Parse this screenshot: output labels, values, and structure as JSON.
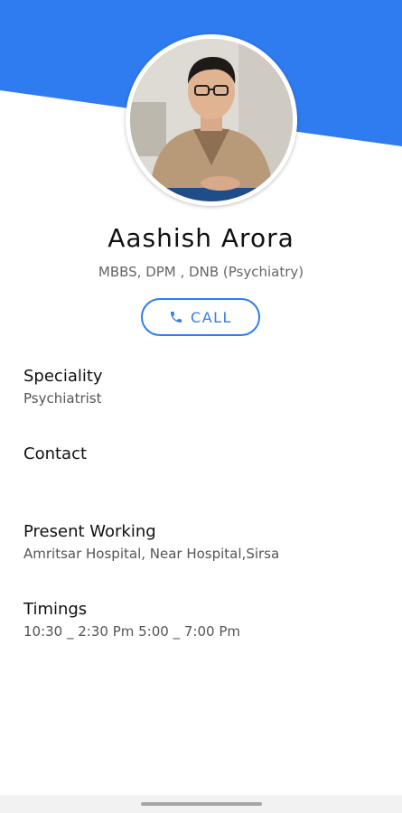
{
  "colors": {
    "accent": "#2f7cf0",
    "text": "#111111",
    "muted": "#555555"
  },
  "profile": {
    "name": "Aashish Arora",
    "degree": "MBBS, DPM , DNB (Psychiatry)",
    "avatar_icon": "doctor-photo"
  },
  "actions": {
    "call_label": "CALL",
    "call_icon": "phone-icon"
  },
  "details": [
    {
      "title": "Speciality",
      "value": "Psychiatrist"
    },
    {
      "title": "Contact",
      "value": ""
    },
    {
      "title": "Present Working",
      "value": "Amritsar Hospital, Near Hospital,Sirsa"
    },
    {
      "title": "Timings",
      "value": "10:30 _ 2:30 Pm 5:00 _ 7:00 Pm"
    }
  ]
}
